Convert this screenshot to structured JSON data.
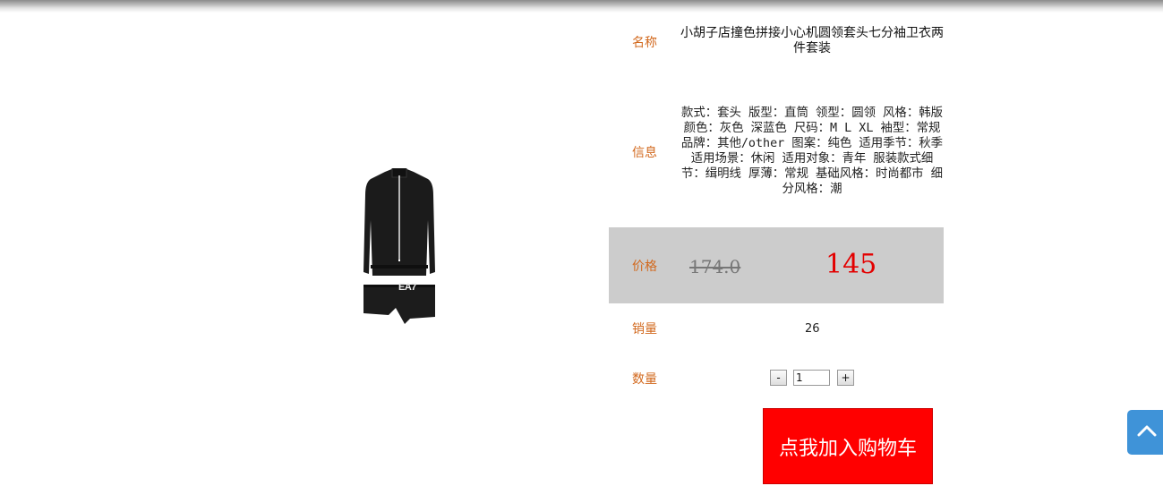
{
  "product": {
    "name_label": "名称",
    "name": "小胡子店撞色拼接小心机圆领套头七分袖卫衣两件套装",
    "info_label": "信息",
    "info": "款式：套头 版型：直筒 领型：圆领 风格：韩版 颜色：灰色 深蓝色 尺码：M L XL 袖型：常规 品牌：其他/other 图案：纯色 适用季节：秋季 适用场景：休闲 适用对象：青年 服装款式细节：缉明线 厚薄：常规 基础风格：时尚都市 细分风格：潮",
    "price_label": "价格",
    "original_price": "174.0",
    "price": "145",
    "sales_label": "销量",
    "sales": "26",
    "quantity_label": "数量",
    "quantity": "1",
    "minus_label": "-",
    "plus_label": "+",
    "add_to_cart_label": "点我加入购物车",
    "image_logo_text": "EA7"
  },
  "icons": {
    "back_to_top": "chevron-up-icon"
  },
  "colors": {
    "label": "#d2691e",
    "price": "#e30000",
    "cart_button": "#ff0000",
    "price_box": "#cccccc",
    "back_to_top": "#3f93d8"
  }
}
